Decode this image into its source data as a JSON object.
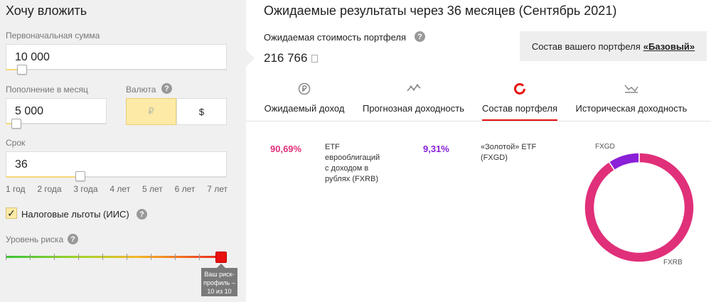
{
  "left": {
    "title": "Хочу вложить",
    "initial_amount": {
      "label": "Первоначальная сумма",
      "value": "10 000"
    },
    "monthly": {
      "label": "Пополнение в месяц",
      "value": "5 000"
    },
    "currency": {
      "label": "Валюта",
      "help": "?",
      "options": [
        "₽",
        "$"
      ],
      "selected": "₽"
    },
    "term": {
      "label": "Срок",
      "value": "36",
      "ticks": [
        "1 год",
        "2 года",
        "3 года",
        "4 лет",
        "5 лет",
        "6 лет",
        "7 лет"
      ]
    },
    "iis": {
      "label": "Налоговые льготы (ИИС)",
      "checked": true,
      "help": "?"
    },
    "risk": {
      "label": "Уровень риска",
      "help": "?",
      "tooltip_lines": [
        "Ваш риск-",
        "профиль –",
        "10 из 10"
      ]
    }
  },
  "right": {
    "title": "Ожидаемые результаты через 36 месяцев (Сентябрь 2021)",
    "expected_label": "Ожидаемая стоимость портфеля",
    "expected_help": "?",
    "expected_value": "216 766",
    "portfolio_prefix": "Состав вашего портфеля",
    "portfolio_name": "«Базовый»",
    "tabs": [
      {
        "label": "Ожидаемый доход",
        "icon": "ruble-coin-icon"
      },
      {
        "label": "Прогнозная доходность",
        "icon": "trend-line-icon"
      },
      {
        "label": "Состав портфеля",
        "icon": "donut-icon",
        "active": true
      },
      {
        "label": "Историческая доходность",
        "icon": "history-chart-icon"
      }
    ],
    "holdings": [
      {
        "pct": "90,69%",
        "name_lines": [
          "ETF",
          "еврооблигаций",
          "с доходом в",
          "рублях (FXRB)"
        ],
        "color": "#e0307a"
      },
      {
        "pct": "9,31%",
        "name_lines": [
          "«Золотой» ETF",
          "(FXGD)"
        ],
        "color": "#8a20d8"
      }
    ]
  },
  "chart_data": {
    "type": "pie",
    "donut": true,
    "categories": [
      "FXRB",
      "FXGD"
    ],
    "values": [
      90.69,
      9.31
    ],
    "colors": [
      "#e0307a",
      "#8a20d8"
    ]
  }
}
